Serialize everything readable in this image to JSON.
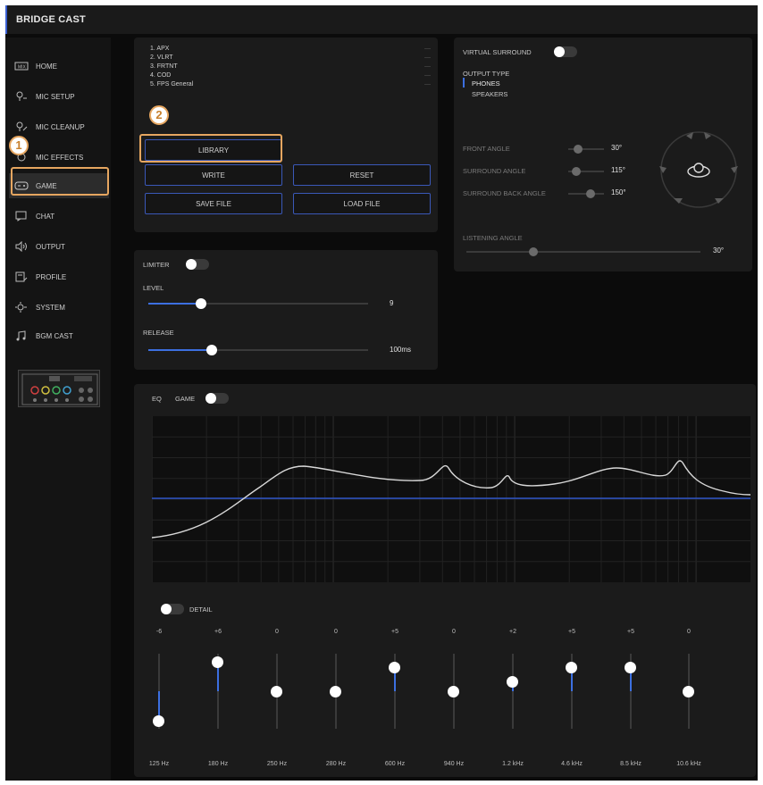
{
  "app": {
    "title": "BRIDGE CAST"
  },
  "sidebar": {
    "items": [
      {
        "label": "HOME",
        "icon": "home-icon"
      },
      {
        "label": "MIC SETUP",
        "icon": "mic-setup-icon"
      },
      {
        "label": "MIC CLEANUP",
        "icon": "mic-cleanup-icon"
      },
      {
        "label": "MIC EFFECTS",
        "icon": "mic-effects-icon"
      },
      {
        "label": "GAME",
        "icon": "gamepad-icon",
        "active": true
      },
      {
        "label": "CHAT",
        "icon": "chat-icon"
      },
      {
        "label": "OUTPUT",
        "icon": "speaker-icon"
      },
      {
        "label": "PROFILE",
        "icon": "profile-icon"
      },
      {
        "label": "SYSTEM",
        "icon": "system-icon"
      },
      {
        "label": "BGM CAST",
        "icon": "music-icon"
      }
    ]
  },
  "callouts": {
    "one": "1",
    "two": "2"
  },
  "library": {
    "presets": [
      "1. APX",
      "2. VLRT",
      "3. FRTNT",
      "4. COD",
      "5. FPS General"
    ],
    "dash": "—",
    "library_label": "LIBRARY",
    "write_label": "WRITE",
    "reset_label": "RESET",
    "save_label": "SAVE FILE",
    "load_label": "LOAD FILE"
  },
  "limiter": {
    "title": "LIMITER",
    "level_label": "LEVEL",
    "level_value": "9",
    "level_fraction": 0.24,
    "release_label": "RELEASE",
    "release_value": "100ms",
    "release_fraction": 0.29
  },
  "surround": {
    "title": "VIRTUAL SURROUND",
    "output_type_label": "OUTPUT TYPE",
    "output_options": [
      "PHONES",
      "SPEAKERS"
    ],
    "selected_output": "PHONES",
    "front_angle_label": "FRONT ANGLE",
    "front_angle_value": "30°",
    "surround_angle_label": "SURROUND ANGLE",
    "surround_angle_value": "115°",
    "surround_back_label": "SURROUND BACK ANGLE",
    "surround_back_value": "150°",
    "listening_angle_label": "LISTENING ANGLE",
    "listening_angle_value": "30°"
  },
  "eq": {
    "title": "EQ",
    "mode": "GAME",
    "detail_label": "DETAIL",
    "bands": [
      {
        "gain": "-6",
        "freq": "125 Hz",
        "level": -6
      },
      {
        "gain": "+6",
        "freq": "180 Hz",
        "level": 6
      },
      {
        "gain": "0",
        "freq": "250 Hz",
        "level": 0
      },
      {
        "gain": "0",
        "freq": "280 Hz",
        "level": 0
      },
      {
        "gain": "+5",
        "freq": "600 Hz",
        "level": 5
      },
      {
        "gain": "0",
        "freq": "940 Hz",
        "level": 0
      },
      {
        "gain": "+2",
        "freq": "1.2 kHz",
        "level": 2
      },
      {
        "gain": "+5",
        "freq": "4.6 kHz",
        "level": 5
      },
      {
        "gain": "+5",
        "freq": "8.5 kHz",
        "level": 5
      },
      {
        "gain": "0",
        "freq": "10.6 kHz",
        "level": 0
      }
    ]
  }
}
